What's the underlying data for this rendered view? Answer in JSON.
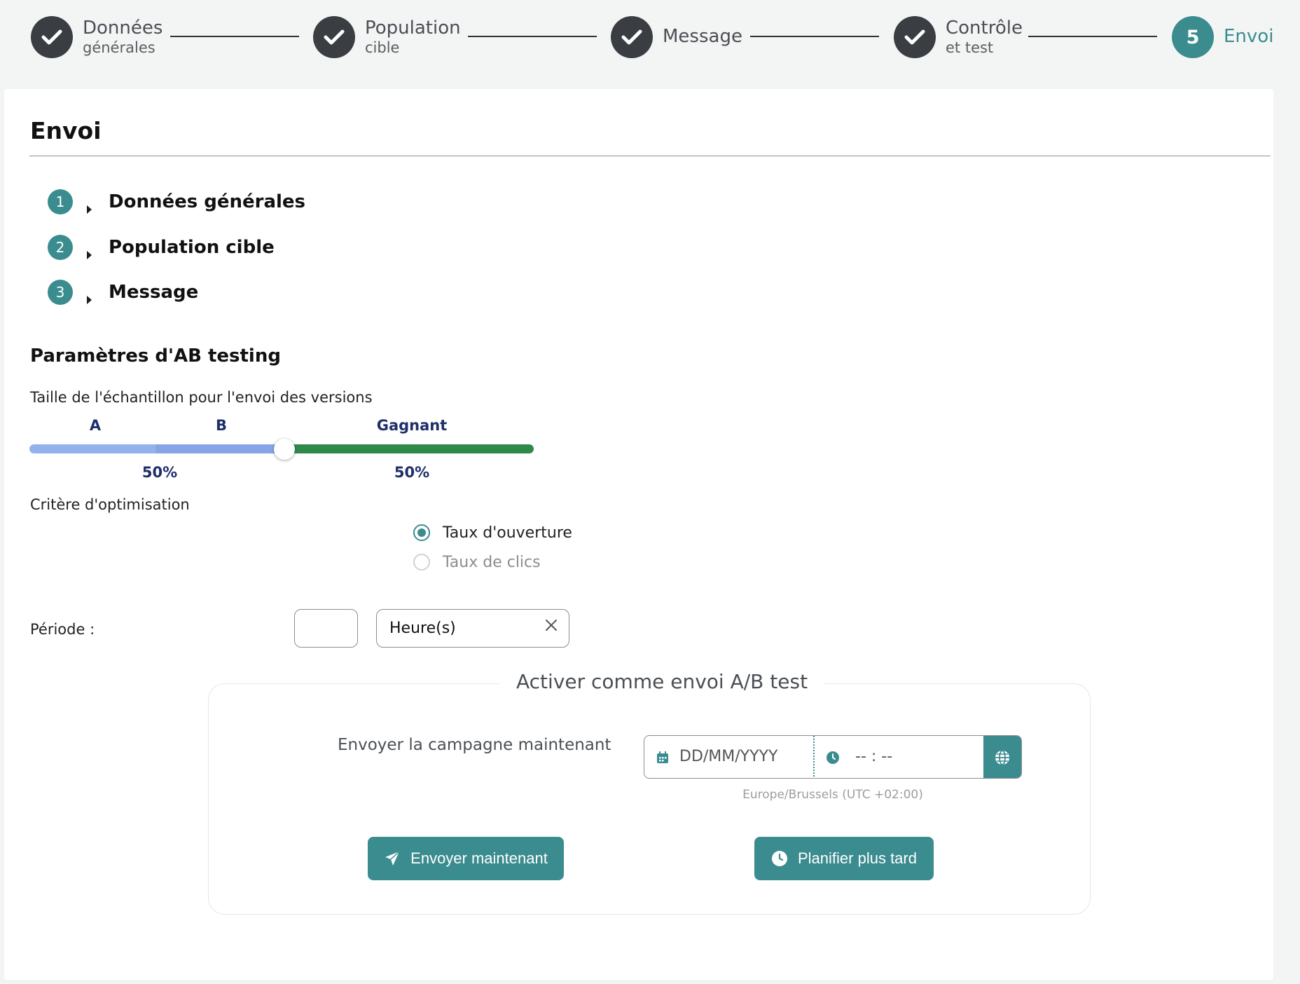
{
  "stepper": {
    "steps": [
      {
        "title": "Données",
        "subtitle": "générales",
        "state": "done"
      },
      {
        "title": "Population",
        "subtitle": "cible",
        "state": "done"
      },
      {
        "title": "Message",
        "subtitle": "",
        "state": "done"
      },
      {
        "title": "Contrôle",
        "subtitle": "et test",
        "state": "done"
      },
      {
        "number": "5",
        "title": "Envoi",
        "subtitle": "",
        "state": "active"
      }
    ]
  },
  "page": {
    "title": "Envoi",
    "summary": [
      {
        "number": "1",
        "label": "Données générales"
      },
      {
        "number": "2",
        "label": "Population cible"
      },
      {
        "number": "3",
        "label": "Message"
      }
    ]
  },
  "ab_settings": {
    "title": "Paramètres d'AB testing",
    "sample_label": "Taille de l'échantillon pour l'envoi des versions",
    "slider": {
      "label_a": "A",
      "label_b": "B",
      "label_winner": "Gagnant",
      "test_percent": 50,
      "test_percent_text": "50%",
      "winner_percent_text": "50%"
    },
    "criteria_label": "Critère d'optimisation",
    "criteria_options": [
      {
        "label": "Taux d'ouverture",
        "selected": true
      },
      {
        "label": "Taux de clics",
        "selected": false
      }
    ],
    "period_label": "Période :",
    "period_value": "",
    "period_unit": "Heure(s)"
  },
  "ab_activation": {
    "legend": "Activer comme envoi A/B test",
    "send_label": "Envoyer la campagne maintenant",
    "date_placeholder": "DD/MM/YYYY",
    "time_placeholder": "-- : --",
    "timezone": "Europe/Brussels (UTC +02:00)",
    "send_now_label": "Envoyer maintenant",
    "schedule_label": "Planifier plus tard"
  },
  "colors": {
    "accent": "#3a8c8f",
    "step_done": "#3a3d42",
    "slider_a": "#93b1ec",
    "slider_b": "#87a4e6",
    "slider_winner": "#2f8a49",
    "slider_label": "#1f2f6a"
  },
  "icons": {
    "step_done": "check-icon",
    "summary_toggle": "caret-right-icon",
    "clear": "close-icon",
    "date": "calendar-icon",
    "time": "clock-icon",
    "timezone": "globe-icon",
    "send": "paper-plane-icon",
    "schedule": "clock-icon"
  }
}
